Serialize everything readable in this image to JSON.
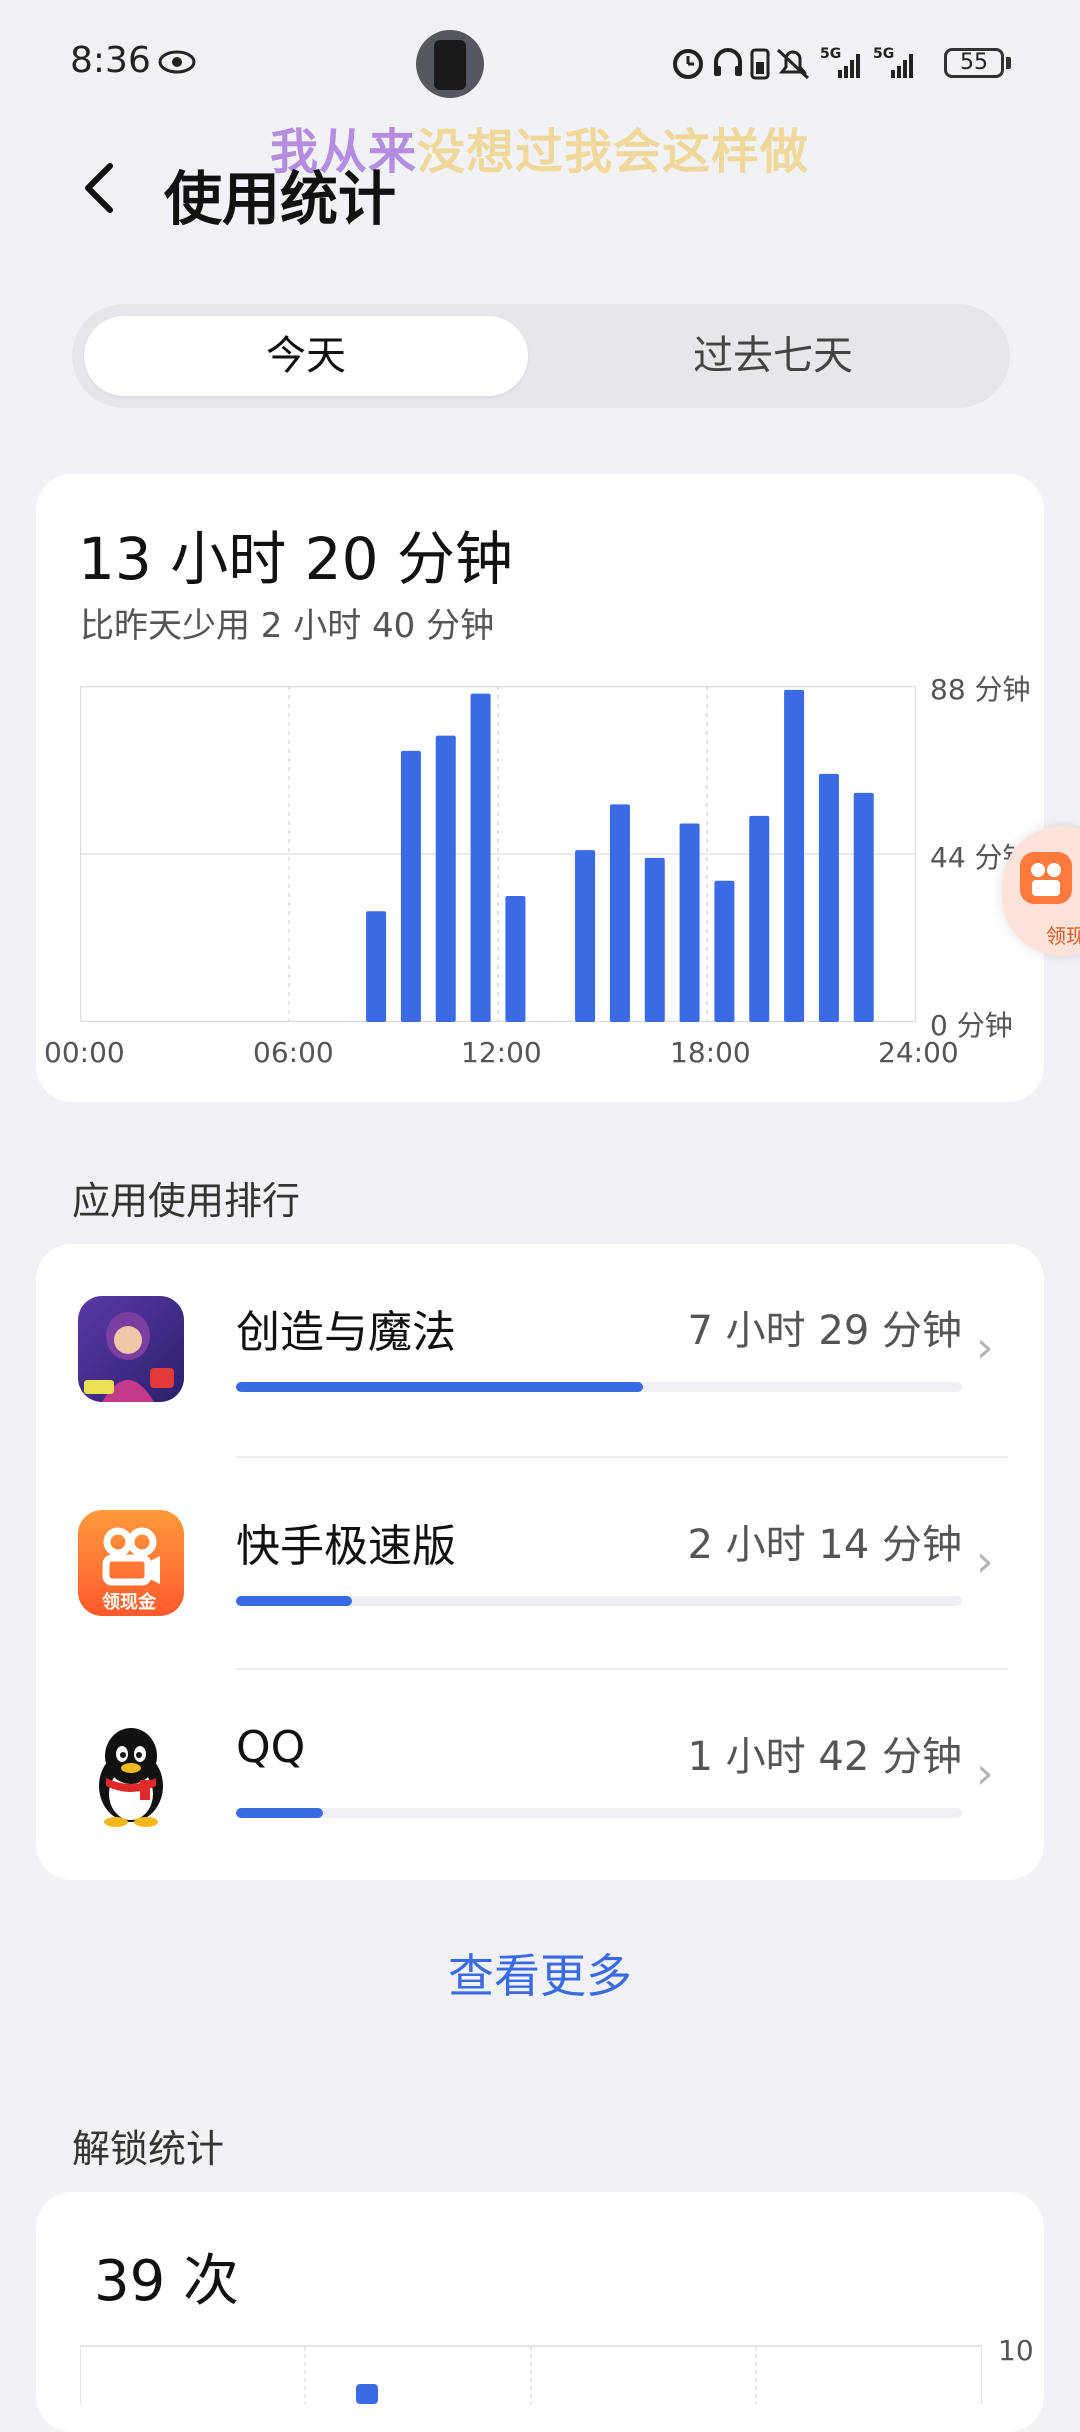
{
  "status_bar": {
    "time": "8:36",
    "battery": "55",
    "icons": [
      "eye-icon",
      "alarm-icon",
      "headphone-icon",
      "battery-saver-icon",
      "mute-icon",
      "signal-5g-icon",
      "signal-5g-icon"
    ]
  },
  "overlay_caption": {
    "part1": "我从来",
    "part2": "没想过我会这样做",
    "color1": "#b48ce0",
    "color2": "#f0d79a"
  },
  "header": {
    "title": "使用统计"
  },
  "tabs": [
    {
      "label": "今天",
      "active": true
    },
    {
      "label": "过去七天",
      "active": false
    }
  ],
  "summary": {
    "total": "13 小时 20 分钟",
    "compare": "比昨天少用 2 小时 40 分钟"
  },
  "chart_data": {
    "type": "bar",
    "y_ticks": [
      "88 分钟",
      "44 分钟",
      "0 分钟"
    ],
    "x_ticks": [
      "00:00",
      "06:00",
      "12:00",
      "18:00",
      "24:00"
    ],
    "ylim": [
      0,
      88
    ],
    "categories": [
      "00",
      "01",
      "02",
      "03",
      "04",
      "05",
      "06",
      "07",
      "08",
      "09",
      "10",
      "11",
      "12",
      "13",
      "14",
      "15",
      "16",
      "17",
      "18",
      "19",
      "20",
      "21",
      "22",
      "23"
    ],
    "values": [
      0,
      0,
      0,
      0,
      0,
      0,
      0,
      0,
      29,
      71,
      75,
      86,
      33,
      0,
      45,
      57,
      43,
      52,
      37,
      54,
      87,
      65,
      60,
      0
    ],
    "bar_color": "#3a6be5"
  },
  "ranking": {
    "title": "应用使用排行",
    "apps": [
      {
        "name": "创造与魔法",
        "time": "7 小时 29 分钟",
        "fraction": 0.56,
        "icon": "game-avatar-icon"
      },
      {
        "name": "快手极速版",
        "time": "2 小时 14 分钟",
        "fraction": 0.16,
        "icon": "kuaishou-icon",
        "icon_text": "领现金"
      },
      {
        "name": "QQ",
        "time": "1 小时 42 分钟",
        "fraction": 0.12,
        "icon": "qq-penguin-icon"
      }
    ],
    "more_label": "查看更多"
  },
  "unlock": {
    "title": "解锁统计",
    "count": "39 次",
    "y_tick_top": "10"
  },
  "side_badge_text": "领现"
}
